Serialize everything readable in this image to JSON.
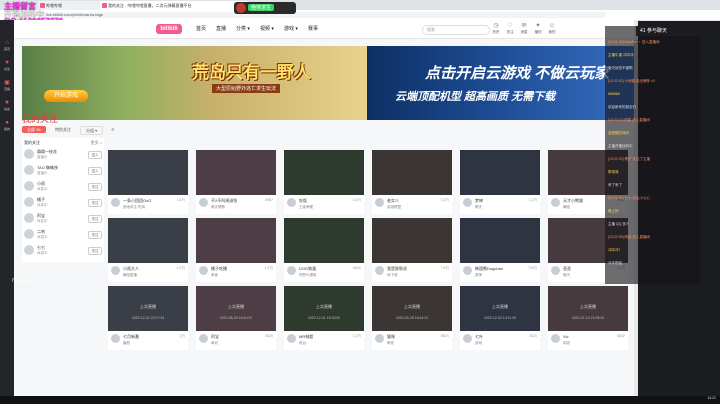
{
  "overlay": {
    "line1": "主播留言",
    "line2": "开播加码中",
    "qq": "QQ:1139057376",
    "stamp_text": "绝地求生",
    "watermark": "Notlar.live"
  },
  "browser": {
    "tabs": [
      {
        "label": "哔哩哔哩"
      },
      {
        "label": "我的关注 - 哔哩哔哩直播，二次元弹幕直播平台"
      }
    ],
    "url": "live.bilibili.com/p/eden/area-tags"
  },
  "rail": [
    "首页",
    "关注",
    "直播",
    "动态",
    "我的"
  ],
  "nav": {
    "logo": "bilibili",
    "links": [
      "首页",
      "直播",
      "分类 ▾",
      "视频 ▾",
      "游戏 ▾",
      "赛事"
    ],
    "search_placeholder": "搜索",
    "icons": [
      {
        "icon": "clock-icon",
        "label": "历史"
      },
      {
        "icon": "heart-icon",
        "label": "关注"
      },
      {
        "icon": "mail-icon",
        "label": "消息"
      },
      {
        "icon": "gift-icon",
        "label": "福利"
      },
      {
        "icon": "user-icon",
        "label": "我的"
      }
    ]
  },
  "banners": {
    "left": {
      "title": "荒岛只有一野人",
      "subtitle": "大型原始野外逃亡求生玩法",
      "button": "开始游戏"
    },
    "right": {
      "title": "点击开启云游戏 不做云玩家",
      "subtitle": "云端顶配机型 超高画质 无需下载"
    }
  },
  "section": {
    "title": "我的关注",
    "filters": [
      "全部 96",
      "特别关注",
      "分组 ▾"
    ],
    "list_header": "我的关注",
    "list_more": "更多 >"
  },
  "follow_list": [
    {
      "name": "璐璐一枝花",
      "status": "直播中",
      "button": "进入"
    },
    {
      "name": "TAO 蜘蛛侠",
      "status": "直播中",
      "button": "进入"
    },
    {
      "name": "小雨",
      "status": "休息中",
      "button": "关注"
    },
    {
      "name": "橘子",
      "status": "休息中",
      "button": "关注"
    },
    {
      "name": "阿宝",
      "status": "休息中",
      "button": "关注"
    },
    {
      "name": "二哈",
      "status": "休息中",
      "button": "关注"
    },
    {
      "name": "七七",
      "status": "休息中",
      "button": "关注"
    }
  ],
  "cards_row1": [
    {
      "name": "一条小团团OvO",
      "views": "1.4万",
      "title": "绝地求生 吃鸡"
    },
    {
      "name": "不2不叫周淑怡",
      "views": "8957",
      "title": "聊天唱歌"
    },
    {
      "name": "吃饭",
      "views": "4.2万",
      "title": "王者荣耀"
    },
    {
      "name": "老实人",
      "views": "3.1万",
      "title": "英雄联盟"
    },
    {
      "name": "梦婷",
      "views": "1.2万",
      "title": "聊天"
    },
    {
      "name": "天才小熊猫",
      "views": "9988",
      "title": "舞蹈"
    }
  ],
  "cards_row2": [
    {
      "name": "小雨大人",
      "views": "2.2万",
      "title": "舞蹈直播"
    },
    {
      "name": "橘子吃播",
      "views": "1.1万",
      "title": "美食"
    },
    {
      "name": "DOG狗蛋",
      "views": "6542",
      "title": "荒野大镖客"
    },
    {
      "name": "我是胖胖虎",
      "views": "7.8万",
      "title": "地下城"
    },
    {
      "name": "韩国熊Dogchan",
      "views": "3.5万",
      "title": "原神"
    },
    {
      "name": "歪歪",
      "views": "2.1万",
      "title": "聊天"
    }
  ],
  "cards_row3": [
    {
      "name": "七月新番",
      "views": "1万",
      "title": "番剧",
      "date": "2020-12-02 23:27:43"
    },
    {
      "name": "阿宝",
      "views": "5320",
      "title": "单机",
      "date": "2020-08-29 16:49:22"
    },
    {
      "name": "MR林超",
      "views": "1.2万",
      "title": "电台",
      "date": "2020-12-01 15:33:52"
    },
    {
      "name": "猫咪",
      "views": "8821",
      "title": "萌宠",
      "date": "2020-09-28 18:44:21"
    },
    {
      "name": "七叶",
      "views": "3021",
      "title": "游戏",
      "date": "2020-12-02 14:11:09"
    },
    {
      "name": "Vic",
      "views": "6632",
      "title": "网游",
      "date": "2020-07-19 21:05:42"
    }
  ],
  "status": {
    "offline": "上次直播"
  },
  "chat": {
    "title": "参与聊天",
    "count": "41",
    "messages": [
      "[13:21:49] NatuRer丶 进入直播间",
      "主播牛逼 冲冲冲",
      "今天状态不错啊",
      "[13:22:02] 小熊猫 送出辣条 x3",
      "666666",
      "欢迎新来的朋友们",
      "[13:22:11] 阿星 进入直播间",
      "这把能吃鸡吗",
      "主播开播加码中",
      "[13:22:30] 橘子 关注了主播",
      "带带我",
      "来了来了",
      "[13:22:41] 七七 送出小心心",
      "晚上好",
      "主播 QQ 多少",
      "[13:22:55] 阿宝 进入直播间",
      "冲冲冲！",
      "今天吃啥"
    ]
  },
  "clock": {
    "time": "13:22",
    "date": "2020/12/2"
  }
}
